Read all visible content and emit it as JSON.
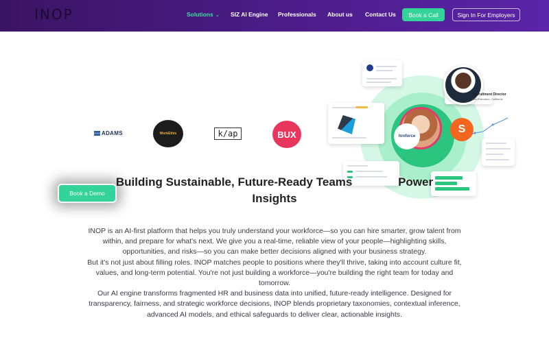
{
  "nav": {
    "logo": "INOP",
    "items": [
      {
        "label": "Solutions",
        "active": true,
        "has_dropdown": true
      },
      {
        "label": "SIZ AI Engine"
      },
      {
        "label": "Professionals"
      },
      {
        "label": "About us"
      },
      {
        "label": "Contact Us"
      }
    ],
    "cta_primary": "Book a Call",
    "cta_secondary": "Sign In For Employers",
    "colors": {
      "bar": "#4c1d8a",
      "accent": "#33d39a",
      "active": "#3ce1a0"
    }
  },
  "partners": [
    {
      "name": "ADAMS"
    },
    {
      "name": "WorkEthix"
    },
    {
      "name": "k/ap"
    },
    {
      "name": "BUX"
    }
  ],
  "illustration": {
    "role_title": "Recruitment Director",
    "role_location": "San Francisco, California",
    "badge_letter": "S",
    "company_bubble": "hrnforce"
  },
  "hero": {
    "title_line1": "Building Sustainable, Future-Ready Teams",
    "title_line1_tail": "Power",
    "title_line2": "Insights",
    "demo_button": "Book a Demo"
  },
  "body": {
    "p1": "INOP is an AI-first platform that helps you truly understand your workforce—so you can hire smarter, grow talent from within, and prepare for what's next. We give you a real-time, reliable view of your people—highlighting skills, opportunities, and risks—so you can make better decisions aligned with your business strategy.",
    "p2": "But it's not just about filling roles. INOP matches people to positions where they'll thrive, taking into account culture fit, values, and long-term potential. You're not just building a workforce—you're building the right team for today and tomorrow.",
    "p3": "Our AI engine transforms fragmented HR and business data into unified, future-ready intelligence. Designed for transparency, fairness, and strategic workforce decisions, INOP blends proprietary taxonomies, contextual inference, advanced AI models, and ethical safeguards to deliver clear, actionable insights."
  }
}
